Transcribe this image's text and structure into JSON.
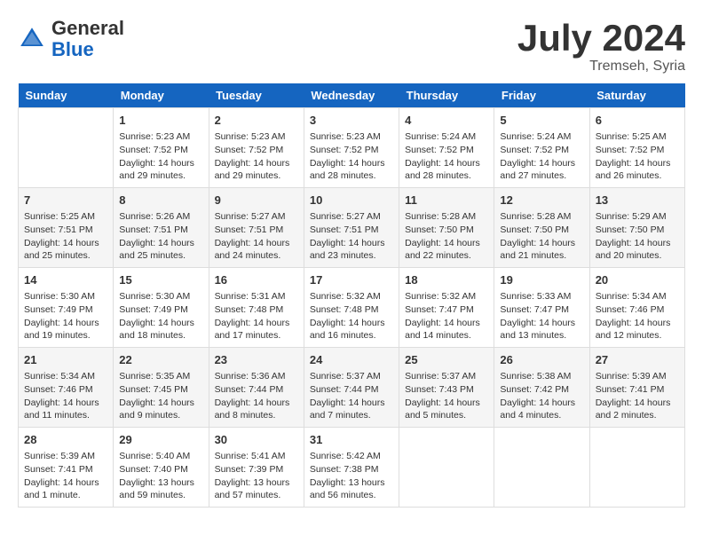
{
  "logo": {
    "general": "General",
    "blue": "Blue"
  },
  "header": {
    "month": "July 2024",
    "location": "Tremseh, Syria"
  },
  "days_of_week": [
    "Sunday",
    "Monday",
    "Tuesday",
    "Wednesday",
    "Thursday",
    "Friday",
    "Saturday"
  ],
  "weeks": [
    [
      {
        "day": "",
        "info": ""
      },
      {
        "day": "1",
        "info": "Sunrise: 5:23 AM\nSunset: 7:52 PM\nDaylight: 14 hours\nand 29 minutes."
      },
      {
        "day": "2",
        "info": "Sunrise: 5:23 AM\nSunset: 7:52 PM\nDaylight: 14 hours\nand 29 minutes."
      },
      {
        "day": "3",
        "info": "Sunrise: 5:23 AM\nSunset: 7:52 PM\nDaylight: 14 hours\nand 28 minutes."
      },
      {
        "day": "4",
        "info": "Sunrise: 5:24 AM\nSunset: 7:52 PM\nDaylight: 14 hours\nand 28 minutes."
      },
      {
        "day": "5",
        "info": "Sunrise: 5:24 AM\nSunset: 7:52 PM\nDaylight: 14 hours\nand 27 minutes."
      },
      {
        "day": "6",
        "info": "Sunrise: 5:25 AM\nSunset: 7:52 PM\nDaylight: 14 hours\nand 26 minutes."
      }
    ],
    [
      {
        "day": "7",
        "info": "Sunrise: 5:25 AM\nSunset: 7:51 PM\nDaylight: 14 hours\nand 25 minutes."
      },
      {
        "day": "8",
        "info": "Sunrise: 5:26 AM\nSunset: 7:51 PM\nDaylight: 14 hours\nand 25 minutes."
      },
      {
        "day": "9",
        "info": "Sunrise: 5:27 AM\nSunset: 7:51 PM\nDaylight: 14 hours\nand 24 minutes."
      },
      {
        "day": "10",
        "info": "Sunrise: 5:27 AM\nSunset: 7:51 PM\nDaylight: 14 hours\nand 23 minutes."
      },
      {
        "day": "11",
        "info": "Sunrise: 5:28 AM\nSunset: 7:50 PM\nDaylight: 14 hours\nand 22 minutes."
      },
      {
        "day": "12",
        "info": "Sunrise: 5:28 AM\nSunset: 7:50 PM\nDaylight: 14 hours\nand 21 minutes."
      },
      {
        "day": "13",
        "info": "Sunrise: 5:29 AM\nSunset: 7:50 PM\nDaylight: 14 hours\nand 20 minutes."
      }
    ],
    [
      {
        "day": "14",
        "info": "Sunrise: 5:30 AM\nSunset: 7:49 PM\nDaylight: 14 hours\nand 19 minutes."
      },
      {
        "day": "15",
        "info": "Sunrise: 5:30 AM\nSunset: 7:49 PM\nDaylight: 14 hours\nand 18 minutes."
      },
      {
        "day": "16",
        "info": "Sunrise: 5:31 AM\nSunset: 7:48 PM\nDaylight: 14 hours\nand 17 minutes."
      },
      {
        "day": "17",
        "info": "Sunrise: 5:32 AM\nSunset: 7:48 PM\nDaylight: 14 hours\nand 16 minutes."
      },
      {
        "day": "18",
        "info": "Sunrise: 5:32 AM\nSunset: 7:47 PM\nDaylight: 14 hours\nand 14 minutes."
      },
      {
        "day": "19",
        "info": "Sunrise: 5:33 AM\nSunset: 7:47 PM\nDaylight: 14 hours\nand 13 minutes."
      },
      {
        "day": "20",
        "info": "Sunrise: 5:34 AM\nSunset: 7:46 PM\nDaylight: 14 hours\nand 12 minutes."
      }
    ],
    [
      {
        "day": "21",
        "info": "Sunrise: 5:34 AM\nSunset: 7:46 PM\nDaylight: 14 hours\nand 11 minutes."
      },
      {
        "day": "22",
        "info": "Sunrise: 5:35 AM\nSunset: 7:45 PM\nDaylight: 14 hours\nand 9 minutes."
      },
      {
        "day": "23",
        "info": "Sunrise: 5:36 AM\nSunset: 7:44 PM\nDaylight: 14 hours\nand 8 minutes."
      },
      {
        "day": "24",
        "info": "Sunrise: 5:37 AM\nSunset: 7:44 PM\nDaylight: 14 hours\nand 7 minutes."
      },
      {
        "day": "25",
        "info": "Sunrise: 5:37 AM\nSunset: 7:43 PM\nDaylight: 14 hours\nand 5 minutes."
      },
      {
        "day": "26",
        "info": "Sunrise: 5:38 AM\nSunset: 7:42 PM\nDaylight: 14 hours\nand 4 minutes."
      },
      {
        "day": "27",
        "info": "Sunrise: 5:39 AM\nSunset: 7:41 PM\nDaylight: 14 hours\nand 2 minutes."
      }
    ],
    [
      {
        "day": "28",
        "info": "Sunrise: 5:39 AM\nSunset: 7:41 PM\nDaylight: 14 hours\nand 1 minute."
      },
      {
        "day": "29",
        "info": "Sunrise: 5:40 AM\nSunset: 7:40 PM\nDaylight: 13 hours\nand 59 minutes."
      },
      {
        "day": "30",
        "info": "Sunrise: 5:41 AM\nSunset: 7:39 PM\nDaylight: 13 hours\nand 57 minutes."
      },
      {
        "day": "31",
        "info": "Sunrise: 5:42 AM\nSunset: 7:38 PM\nDaylight: 13 hours\nand 56 minutes."
      },
      {
        "day": "",
        "info": ""
      },
      {
        "day": "",
        "info": ""
      },
      {
        "day": "",
        "info": ""
      }
    ]
  ]
}
